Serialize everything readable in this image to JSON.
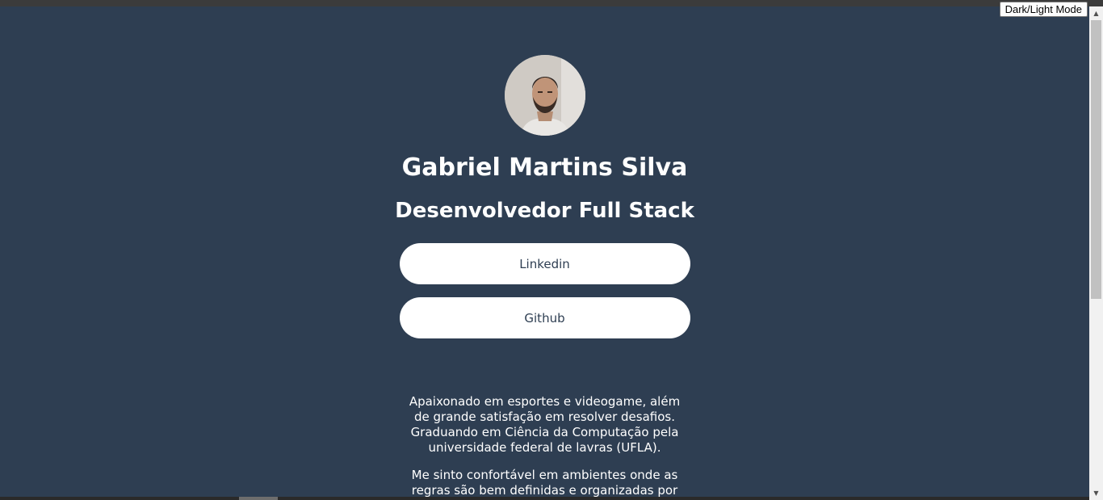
{
  "toolbar": {
    "theme_toggle_label": "Dark/Light Mode"
  },
  "profile": {
    "name": "Gabriel Martins Silva",
    "role": "Desenvolvedor Full Stack",
    "avatar_icon": "profile-photo"
  },
  "links": [
    {
      "label": "Linkedin"
    },
    {
      "label": "Github"
    }
  ],
  "bio": [
    "Apaixonado em esportes e videogame, além de grande satisfação em resolver desafios. Graduando em Ciência da Computação pela universidade federal de lavras (UFLA).",
    "Me sinto confortável em ambientes onde as regras são bem definidas e organizadas por"
  ],
  "colors": {
    "background": "#2e3e52",
    "button_background": "#ffffff",
    "button_text": "#2e3e52",
    "text": "#ffffff"
  },
  "scrollbar": {
    "up_icon": "arrow-up-icon",
    "down_icon": "arrow-down-icon"
  }
}
